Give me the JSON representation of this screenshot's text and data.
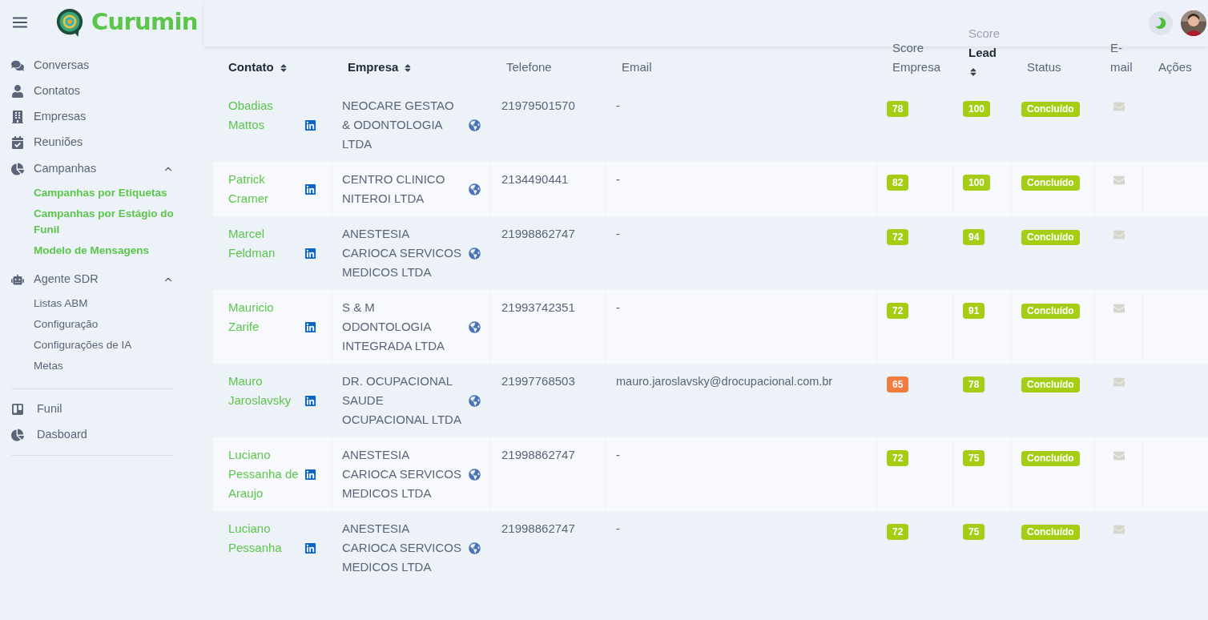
{
  "brand": {
    "name": "Curumin"
  },
  "sidebar": {
    "items": [
      {
        "kind": "link",
        "label": "Conversas"
      },
      {
        "kind": "link",
        "label": "Contatos"
      },
      {
        "kind": "link",
        "label": "Empresas"
      },
      {
        "kind": "link",
        "label": "Reuniões"
      },
      {
        "kind": "group",
        "label": "Campanhas",
        "expanded": true,
        "children": [
          {
            "label": "Campanhas por Etiquetas",
            "selected": true
          },
          {
            "label": "Campanhas por Estágio do Funil",
            "selected": true
          },
          {
            "label": "Modelo de Mensagens",
            "selected": true
          }
        ]
      },
      {
        "kind": "group",
        "label": "Agente SDR",
        "expanded": true,
        "children": [
          {
            "label": "Listas ABM",
            "selected": false
          },
          {
            "label": "Configuração",
            "selected": false
          },
          {
            "label": "Configurações de IA",
            "selected": false
          },
          {
            "label": "Metas",
            "selected": false
          }
        ]
      },
      {
        "kind": "divider"
      },
      {
        "kind": "link",
        "label": "Funil"
      },
      {
        "kind": "link",
        "label": "Dasboard"
      },
      {
        "kind": "divider"
      }
    ]
  },
  "table": {
    "columns": [
      {
        "lines": [
          "Contato"
        ],
        "sortable": true
      },
      {
        "lines": [
          "Empresa"
        ],
        "sortable": true
      },
      {
        "lines": [
          "Telefone"
        ],
        "sortable": false
      },
      {
        "lines": [
          "Email"
        ],
        "sortable": false
      },
      {
        "lines": [
          "Score",
          "Empresa"
        ],
        "sortable": false
      },
      {
        "lines": [
          "Score",
          "Lead"
        ],
        "sortable": true
      },
      {
        "lines": [
          "Status"
        ],
        "sortable": false
      },
      {
        "lines": [
          "E-",
          "mail"
        ],
        "sortable": false
      },
      {
        "lines": [
          "Ações"
        ],
        "sortable": false
      }
    ],
    "rows": [
      {
        "contact": "Obadias Mattos",
        "company": "NEOCARE GESTAO & ODONTOLOGIA LTDA",
        "phone": "21979501570",
        "email": "-",
        "score_company": {
          "value": "78",
          "color": "#a5cd14"
        },
        "score_lead": {
          "value": "100",
          "color": "#a5cd14"
        },
        "status": "Concluído"
      },
      {
        "contact": "Patrick Cramer",
        "company": "CENTRO CLINICO NITEROI LTDA",
        "phone": "2134490441",
        "email": "-",
        "score_company": {
          "value": "82",
          "color": "#a5cd14"
        },
        "score_lead": {
          "value": "100",
          "color": "#a5cd14"
        },
        "status": "Concluído"
      },
      {
        "contact": "Marcel Feldman",
        "company": "ANESTESIA CARIOCA SERVICOS MEDICOS LTDA",
        "phone": "21998862747",
        "email": "-",
        "score_company": {
          "value": "72",
          "color": "#a5cd14"
        },
        "score_lead": {
          "value": "94",
          "color": "#a5cd14"
        },
        "status": "Concluído"
      },
      {
        "contact": "Mauricio Zarife",
        "company": "S & M ODONTOLOGIA INTEGRADA LTDA",
        "phone": "21993742351",
        "email": "-",
        "score_company": {
          "value": "72",
          "color": "#a5cd14"
        },
        "score_lead": {
          "value": "91",
          "color": "#a5cd14"
        },
        "status": "Concluído"
      },
      {
        "contact": "Mauro Jaroslavsky",
        "company": "DR. OCUPACIONAL SAUDE OCUPACIONAL LTDA",
        "phone": "21997768503",
        "email": "mauro.jaroslavsky@drocupacional.com.br",
        "score_company": {
          "value": "65",
          "color": "#f47b3e"
        },
        "score_lead": {
          "value": "78",
          "color": "#a5cd14"
        },
        "status": "Concluído"
      },
      {
        "contact": "Luciano Pessanha de Araujo",
        "company": "ANESTESIA CARIOCA SERVICOS MEDICOS LTDA",
        "phone": "21998862747",
        "email": "-",
        "score_company": {
          "value": "72",
          "color": "#a5cd14"
        },
        "score_lead": {
          "value": "75",
          "color": "#a5cd14"
        },
        "status": "Concluído"
      },
      {
        "contact": "Luciano Pessanha",
        "company": "ANESTESIA CARIOCA SERVICOS MEDICOS LTDA",
        "phone": "21998862747",
        "email": "-",
        "score_company": {
          "value": "72",
          "color": "#a5cd14"
        },
        "score_lead": {
          "value": "75",
          "color": "#a5cd14"
        },
        "status": "Concluído"
      }
    ]
  }
}
